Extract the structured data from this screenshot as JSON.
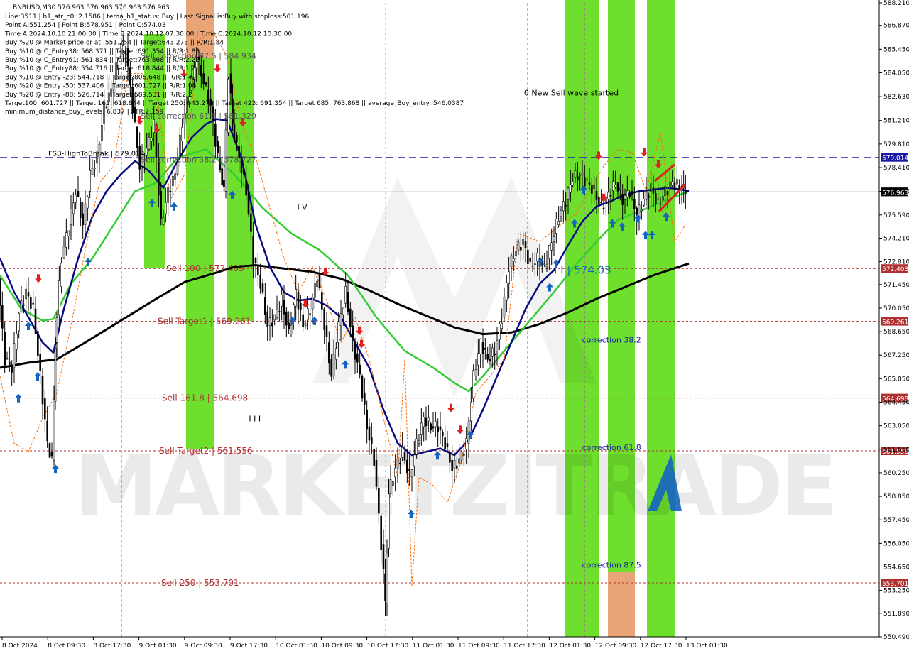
{
  "chart_data": {
    "type": "candlestick",
    "symbol_header": "BNBUSD,M30  576.963 576.963 576.963 576.963",
    "info_lines": [
      "Line:3511  |  h1_atr_c0: 2.1586  |  tema_h1_status: Buy  |  Last Signal is:Buy with stoploss:501.196",
      "Point A:551.254  |  Point B:578.951  |  Point C:574.03",
      "Time A:2024.10.10 21:00:00  |  Time B:2024.10.12 07:30:00  |  Time C:2024.10.12 10:30:00",
      "Buy %20 @ Market price or at: 551.254  ||  Target:643.273  ||  R/R:1.84",
      "Buy %10 @ C_Entry38: 568.371  ||  Target:691.354  ||  R/R:1.83",
      "Buy %10 @ C_Entry61: 561.834  ||  Target:763.868  ||  R/R:2.22",
      "Buy %10 @ C_Entry88: 554.716  ||  Target:618.844  ||  R/R:1.2",
      "Buy %10 @ Entry -23: 544.718  ||  Target:806.648  ||  R/R:1.42",
      "Buy %20 @ Entry -50: 537.406  ||  Target:601.727  ||  R/R:1.08",
      "Buy %20 @ Entry -88: 526.714  ||  Target:589.531  ||  R/R:2.2",
      "Target100: 601.727  ||  Target 161: 618.844  ||  Target 250: 643.273  ||  Target 423: 691.354  ||  Target 685: 763.868  ||  average_Buy_entry: 546.0387",
      "minimum_distance_buy_levels: 6.837  |  ATR:2.159"
    ],
    "y_range": [
      550.49,
      588.21
    ],
    "y_ticks": [
      "588.210",
      "586.870",
      "585.450",
      "584.050",
      "582.630",
      "581.210",
      "579.810",
      "578.410",
      "576.990",
      "575.590",
      "574.210",
      "572.810",
      "571.450",
      "570.050",
      "568.650",
      "567.250",
      "565.850",
      "564.450",
      "563.050",
      "561.650",
      "560.250",
      "558.850",
      "557.450",
      "556.050",
      "554.650",
      "553.250",
      "551.890",
      "550.490"
    ],
    "x_labels": [
      "8 Oct 2024",
      "8 Oct 09:30",
      "8 Oct 17:30",
      "9 Oct 01:30",
      "9 Oct 09:30",
      "9 Oct 17:30",
      "10 Oct 01:30",
      "10 Oct 09:30",
      "10 Oct 17:30",
      "11 Oct 01:30",
      "11 Oct 09:30",
      "11 Oct 17:30",
      "12 Oct 01:30",
      "12 Oct 09:30",
      "12 Oct 17:30",
      "13 Oct 01:30"
    ],
    "current_price": "576.963",
    "levels": [
      {
        "price": 579.014,
        "label": "579.014",
        "line_text": "FSB-HighToBreak | 579.014",
        "style": "blue-dash"
      },
      {
        "price": 576.963,
        "label": "576.963",
        "line_text": "",
        "style": "price"
      },
      {
        "price": 572.403,
        "label": "572.403",
        "line_text": "Sell 100 | 572.403",
        "style": "red-dot"
      },
      {
        "price": 569.261,
        "label": "569.261",
        "line_text": "Sell Target1 | 569.261",
        "style": "red-dot"
      },
      {
        "price": 564.698,
        "label": "564.698",
        "line_text": "Sell 161.8 | 564.698",
        "style": "red-dot"
      },
      {
        "price": 561.556,
        "label": "561.556",
        "line_text": "Sell Target2 | 561.556",
        "style": "red-dot"
      },
      {
        "price": 553.701,
        "label": "553.701",
        "line_text": "Sell 250 | 553.701",
        "style": "red-dot"
      }
    ],
    "annotations": [
      {
        "text": "0 New Sell wave started",
        "color": "#000000",
        "price": 582.7,
        "time": 0.596
      },
      {
        "text": "I V",
        "color": "#000000",
        "price": 575.9,
        "time": 0.338
      },
      {
        "text": "I I I",
        "color": "#000000",
        "price": 563.3,
        "time": 0.283
      },
      {
        "text": "I I | 574.03",
        "color": "#1565c0",
        "price": 572.1,
        "time": 0.63
      },
      {
        "text": "I",
        "color": "#1565c0",
        "price": 580.6,
        "time": 0.638
      },
      {
        "text": "correction 38.2",
        "color": "#1a1aa6",
        "price": 568.0,
        "time": 0.662
      },
      {
        "text": "correction 61.8",
        "color": "#1a1aa6",
        "price": 561.6,
        "time": 0.662
      },
      {
        "text": "correction 87.5",
        "color": "#1a1aa6",
        "price": 554.6,
        "time": 0.662
      },
      {
        "text": "Sell correction 87.5 | 584.934",
        "color": "#555555",
        "price": 584.9,
        "time": 0.16
      },
      {
        "text": "Sell correction 61.8 | 581.329",
        "color": "#555555",
        "price": 581.33,
        "time": 0.16
      },
      {
        "text": "Sell correction 38.2 | 578.727",
        "color": "#555555",
        "price": 578.73,
        "time": 0.16
      }
    ],
    "watermark": "MARKETZITRADE",
    "colors": {
      "green_zone": "#66dd22",
      "orange_zone": "#e8a070",
      "ma_black": "#000000",
      "ma_navy": "#0a0a80",
      "ma_green": "#33cc33",
      "candles": "#000000",
      "buy_arrow": "#1565c0",
      "sell_arrow": "#e02020",
      "level_red": "#b03030",
      "level_blue": "#1a1aa6"
    }
  }
}
